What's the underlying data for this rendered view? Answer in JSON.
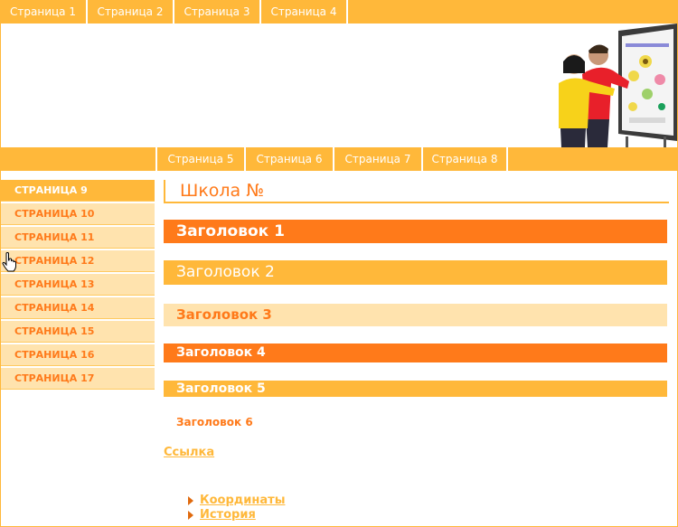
{
  "top_nav": [
    "Страница 1",
    "Страница 2",
    "Страница 3",
    "Страница 4"
  ],
  "sub_nav": [
    "Страница 5",
    "Страница 6",
    "Страница 7",
    "Страница 8"
  ],
  "sidebar": {
    "items": [
      "СТРАНИЦА 9",
      "СТРАНИЦА 10",
      "СТРАНИЦА 11",
      "СТРАНИЦА 12",
      "СТРАНИЦА 13",
      "СТРАНИЦА 14",
      "СТРАНИЦА 15",
      "СТРАНИЦА 16",
      "СТРАНИЦА 17"
    ],
    "active": "СТРАНИЦА 9"
  },
  "content": {
    "title": "Школа №",
    "headings": [
      "Заголовок 1",
      "Заголовок 2",
      "Заголовок 3",
      "Заголовок 4",
      "Заголовок 5",
      "Заголовок 6"
    ],
    "link": "Ссылка",
    "list": [
      "Координаты",
      "История"
    ]
  },
  "colors": {
    "accent": "#FFB83A",
    "dark_accent": "#FF7A1A",
    "light_accent": "#FFE3AE"
  },
  "icons": {
    "cursor": "hand-pointer-icon",
    "hero": "students-at-interactive-board-image"
  }
}
